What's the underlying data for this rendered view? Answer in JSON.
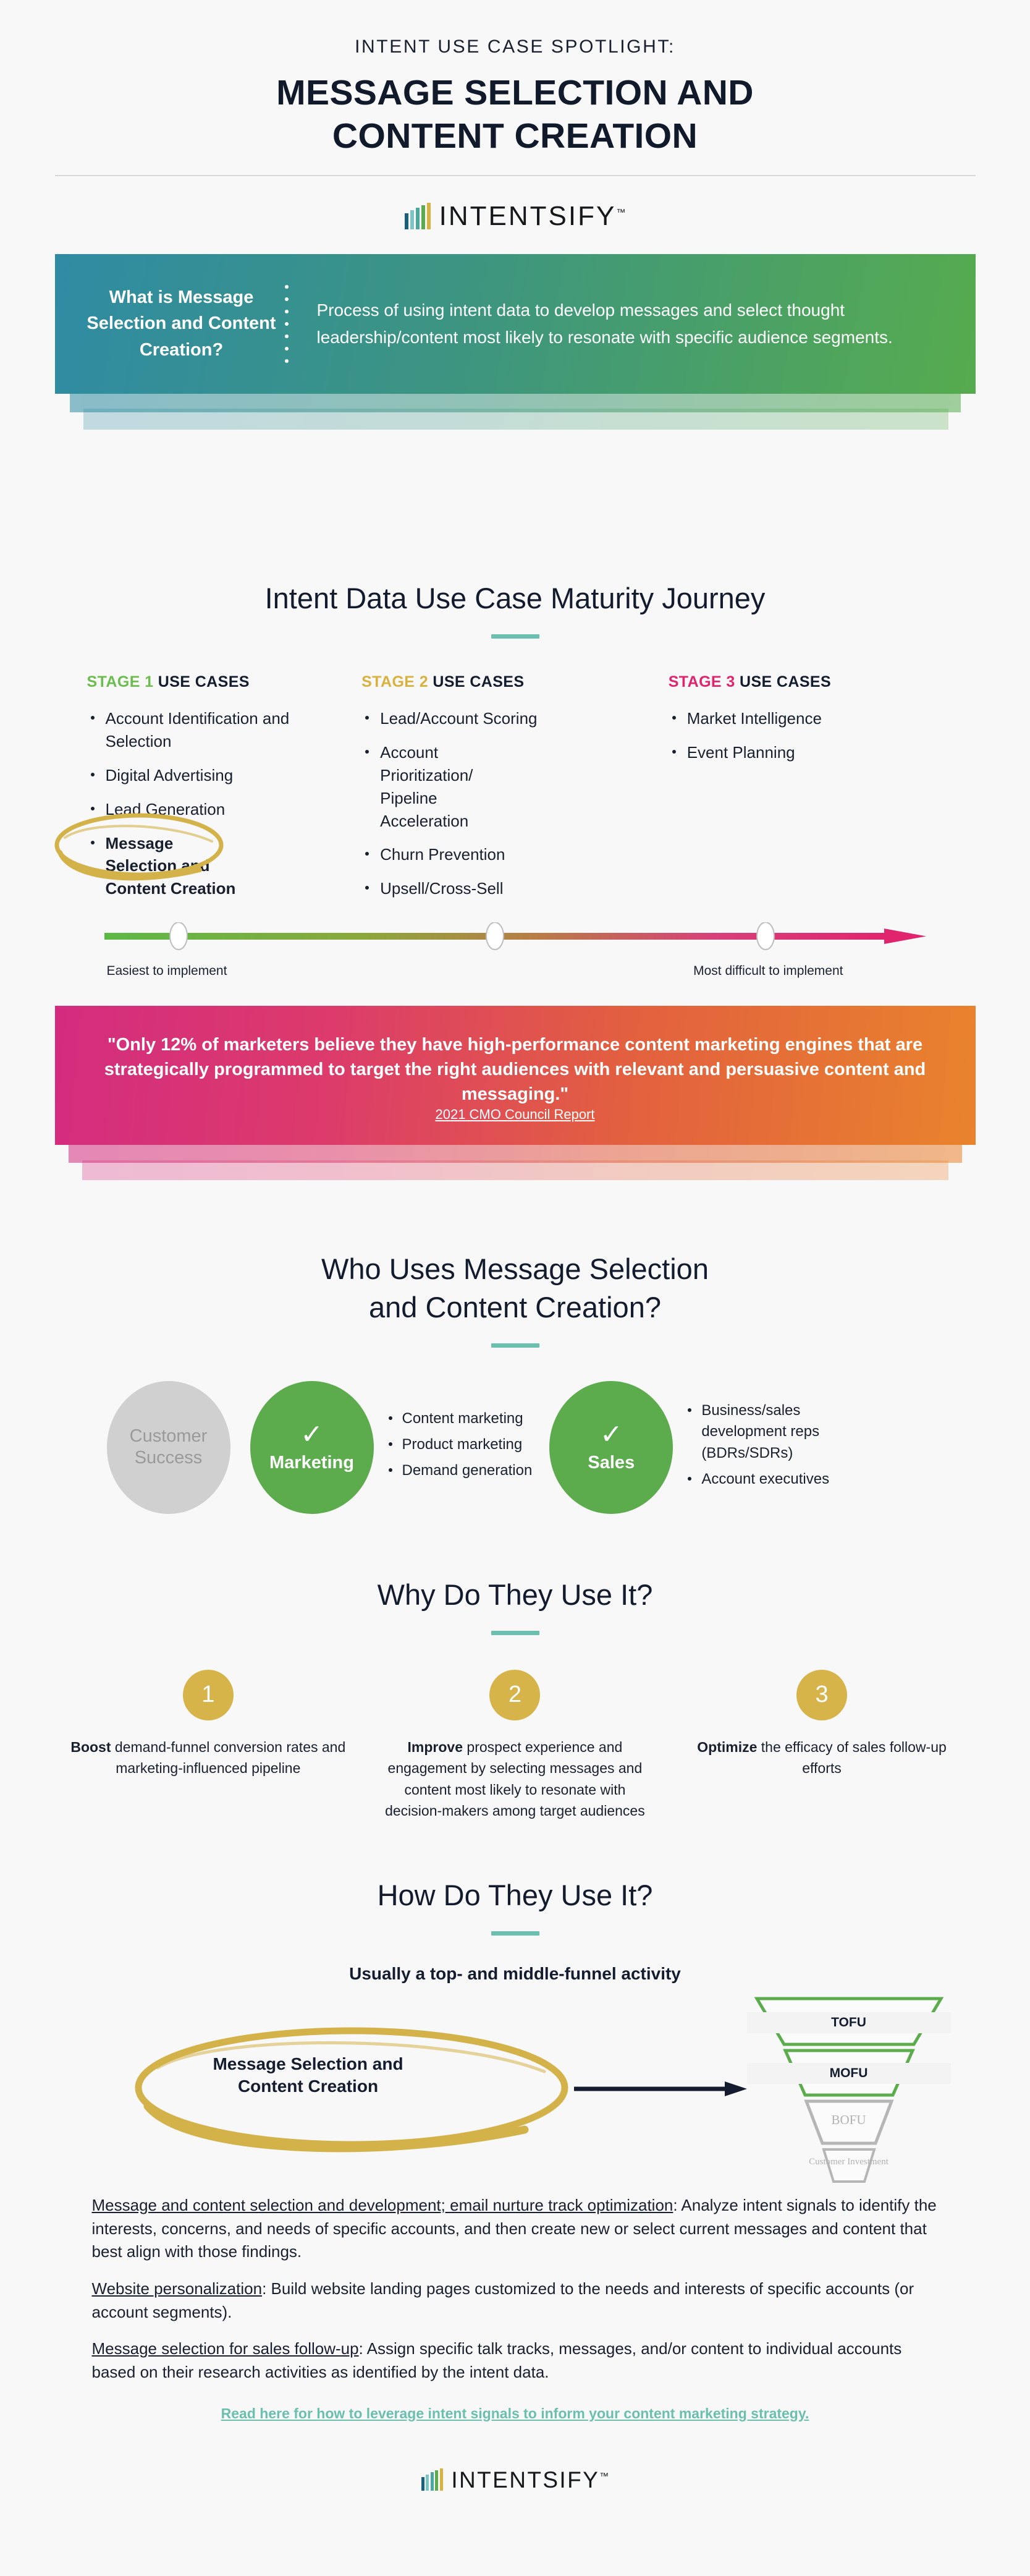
{
  "header": {
    "eyebrow": "INTENT USE CASE SPOTLIGHT:",
    "title_line1": "MESSAGE SELECTION AND",
    "title_line2": "CONTENT CREATION"
  },
  "logo": {
    "word": "INTENTSIFY",
    "tm": "™",
    "bar_colors": [
      "#1b5f7e",
      "#7fc4c4",
      "#4aa7a0",
      "#5cac4e",
      "#d9b13e"
    ]
  },
  "definition": {
    "label": "What is Message Selection and Content Creation?",
    "description": "Process of using intent data to develop messages and select thought leadership/content most likely to resonate with specific audience segments.",
    "gradient_start": "#2f8ba3",
    "gradient_end": "#56ab4e"
  },
  "maturity": {
    "heading": "Intent Data Use Case Maturity Journey",
    "stages": [
      {
        "prefix": "STAGE 1",
        "suffix": " USE CASES",
        "color": "#6bbd4e",
        "items": [
          {
            "text": "Account Identification and Selection",
            "highlight": false
          },
          {
            "text": "Digital Advertising",
            "highlight": false
          },
          {
            "text": "Lead Generation",
            "highlight": false
          },
          {
            "text": "Message Selection and Content Creation",
            "highlight": true
          }
        ]
      },
      {
        "prefix": "STAGE 2",
        "suffix": " USE CASES",
        "color": "#d9b13e",
        "items": [
          {
            "text": "Lead/Account Scoring",
            "highlight": false
          },
          {
            "text": "Account Prioritization/ Pipeline Acceleration",
            "highlight": false
          },
          {
            "text": "Churn Prevention",
            "highlight": false
          },
          {
            "text": "Upsell/Cross-Sell",
            "highlight": false
          }
        ]
      },
      {
        "prefix": "STAGE 3",
        "suffix": " USE CASES",
        "color": "#e0246e",
        "items": [
          {
            "text": "Market Intelligence",
            "highlight": false
          },
          {
            "text": "Event Planning",
            "highlight": false
          }
        ]
      }
    ],
    "scale_left": "Easiest to implement",
    "scale_right": "Most difficult to implement",
    "scale_gradient_start": "#5cb846",
    "scale_gradient_end": "#e0246e"
  },
  "quote": {
    "text": "\"Only 12% of marketers believe they have high-performance content marketing engines that are strategically programmed to target the right audiences with relevant and persuasive content and messaging.\"",
    "source": "2021 CMO Council Report",
    "gradient_start": "#d32c7f",
    "gradient_end": "#e9832d"
  },
  "who": {
    "heading_line1": "Who Uses Message Selection",
    "heading_line2": "and Content Creation?",
    "groups": [
      {
        "name": "Customer Success",
        "active": false,
        "check": "",
        "color": "#d0d0d0",
        "items": []
      },
      {
        "name": "Marketing",
        "active": true,
        "check": "✓",
        "color": "#5cac4e",
        "items": [
          "Content marketing",
          "Product marketing",
          "Demand generation"
        ]
      },
      {
        "name": "Sales",
        "active": true,
        "check": "✓",
        "color": "#5cac4e",
        "items": [
          "Business/sales development reps (BDRs/SDRs)",
          "Account executives"
        ]
      }
    ]
  },
  "why": {
    "heading": "Why Do They Use It?",
    "reasons": [
      {
        "num": "1",
        "bold": "Boost",
        "rest": " demand-funnel conversion rates and marketing-influenced pipeline"
      },
      {
        "num": "2",
        "bold": "Improve",
        "rest": " prospect experience and engagement by selecting messages and content most likely to resonate with decision-makers among target audiences"
      },
      {
        "num": "3",
        "bold": "Optimize",
        "rest": " the efficacy of sales follow-up efforts"
      }
    ],
    "badge_color": "#d6b44a"
  },
  "how": {
    "heading": "How Do They Use It?",
    "subheading": "Usually a top- and middle-funnel activity",
    "pill_label": "Message Selection and Content Creation",
    "funnel": [
      {
        "label": "TOFU",
        "active": true
      },
      {
        "label": "MOFU",
        "active": true
      },
      {
        "label": "BOFU",
        "active": false
      },
      {
        "label": "Customer Investment",
        "active": false
      }
    ]
  },
  "details": [
    {
      "lead": "Message and content selection and development; email nurture track optimization",
      "body": ": Analyze intent signals to identify the interests, concerns, and needs of specific accounts, and then create new or select current messages and content that best align with those findings."
    },
    {
      "lead": "Website personalization",
      "body": ": Build website landing pages customized to the needs and interests of specific accounts (or account segments)."
    },
    {
      "lead": "Message selection for sales follow-up",
      "body": ": Assign specific talk tracks, messages, and/or content to individual accounts based on their research activities as identified by the intent data."
    }
  ],
  "cta": "Read here for how to leverage intent signals to inform your content marketing strategy."
}
